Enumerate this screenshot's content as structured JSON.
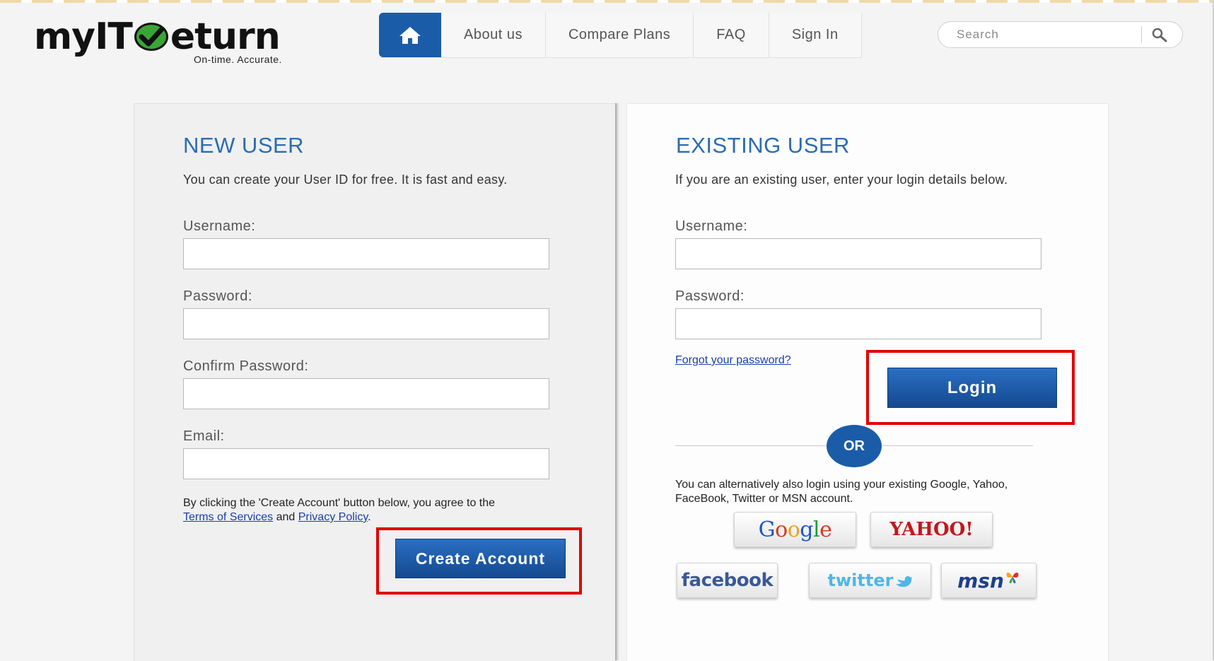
{
  "brand": {
    "logo_left": "myIT",
    "logo_right": "eturn",
    "tagline": "On-time. Accurate."
  },
  "nav": {
    "home_icon": "home-icon",
    "items": [
      "About us",
      "Compare Plans",
      "FAQ",
      "Sign In"
    ]
  },
  "search": {
    "placeholder": "Search",
    "icon": "magnifier-icon"
  },
  "new_user": {
    "heading": "NEW USER",
    "subtext": "You can create your User ID for free. It is fast and easy.",
    "username_label": "Username:",
    "password_label": "Password:",
    "confirm_label": "Confirm Password:",
    "email_label": "Email:",
    "agree_text": "By clicking the 'Create Account' button below, you agree to the",
    "terms_link": "Terms of Services",
    "and_text": "and",
    "privacy_link": "Privacy Policy",
    "period": ".",
    "create_button": "Create Account"
  },
  "existing_user": {
    "heading": "EXISTING USER",
    "subtext": "If you are an existing user, enter your login details below.",
    "username_label": "Username:",
    "password_label": "Password:",
    "forgot_link": "Forgot your password?",
    "login_button": "Login",
    "or_text": "OR",
    "alt_text": "You can alternatively also login using your existing Google, Yahoo, FaceBook, Twitter or MSN account."
  },
  "social": {
    "google": "Google",
    "yahoo": "YAHOO!",
    "facebook": "facebook",
    "twitter": "twitter",
    "msn": "msn"
  },
  "colors": {
    "accent": "#1a5ca8",
    "heading": "#2a6cb5",
    "highlight": "#e00000",
    "logo_check": "#3aa535"
  }
}
